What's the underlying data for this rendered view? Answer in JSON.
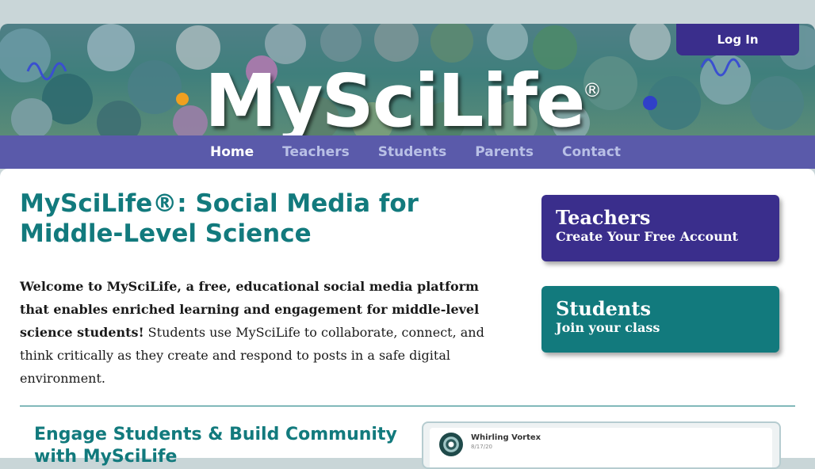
{
  "site": {
    "logo_text": "MySciLife",
    "logo_mark": "®"
  },
  "header": {
    "login_label": "Log In"
  },
  "nav": {
    "items": [
      {
        "label": "Home",
        "active": true
      },
      {
        "label": "Teachers",
        "active": false
      },
      {
        "label": "Students",
        "active": false
      },
      {
        "label": "Parents",
        "active": false
      },
      {
        "label": "Contact",
        "active": false
      }
    ]
  },
  "main": {
    "headline": "MySciLife®: Social Media for Middle-Level Science",
    "intro_bold": "Welcome to MySciLife, a free, educational social media platform that enables enriched learning and engagement for middle-level science students!",
    "intro_rest": " Students use MySciLife to collaborate, connect, and think critically as they create and respond to posts in a safe digital environment.",
    "cta_teachers": {
      "title": "Teachers",
      "subtitle": "Create Your Free Account"
    },
    "cta_students": {
      "title": "Students",
      "subtitle": "Join your class"
    },
    "subhead": "Engage Students & Build Community with MySciLife"
  },
  "preview": {
    "post_name": "Whirling Vortex",
    "post_date": "8/17/20"
  },
  "colors": {
    "brand_purple": "#3a2e8c",
    "brand_teal": "#127a7d"
  }
}
